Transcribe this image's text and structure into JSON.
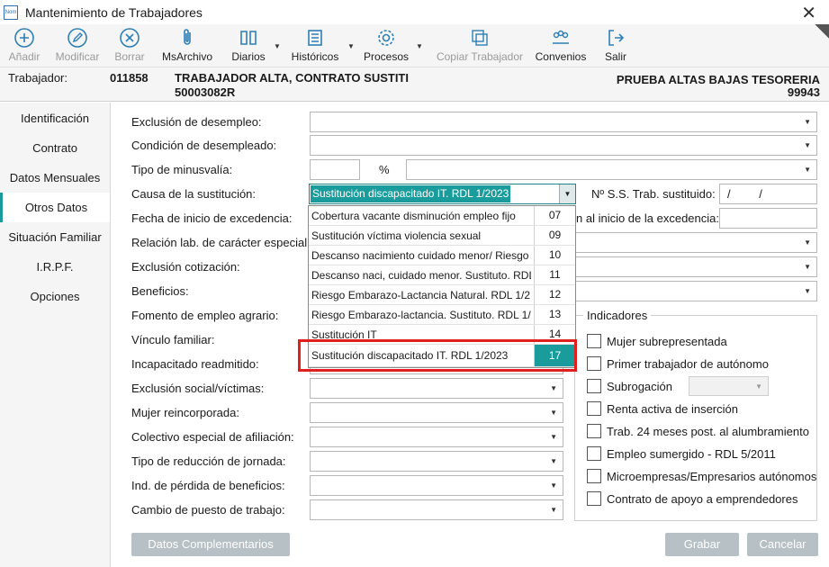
{
  "window": {
    "title": "Mantenimiento de Trabajadores",
    "icon_text": "Nom"
  },
  "toolbar": {
    "anadir": "Añadir",
    "modificar": "Modificar",
    "borrar": "Borrar",
    "msarchivo": "MsArchivo",
    "diarios": "Diarios",
    "historicos": "Históricos",
    "procesos": "Procesos",
    "copiar": "Copiar Trabajador",
    "convenios": "Convenios",
    "salir": "Salir"
  },
  "info": {
    "trabajador_label": "Trabajador:",
    "codigo": "011858",
    "nombre": "TRABAJADOR ALTA, CONTRATO SUSTITI",
    "id": "50003082R",
    "empresa": "PRUEBA ALTAS BAJAS TESORERIA",
    "empresa_code": "99943"
  },
  "nav": [
    "Identificación",
    "Contrato",
    "Datos Mensuales",
    "Otros Datos",
    "Situación Familiar",
    "I.R.P.F.",
    "Opciones"
  ],
  "fields": {
    "exclusion_desempleo": "Exclusión de desempleo:",
    "condicion_desempleado": "Condición de desempleado:",
    "tipo_minusvalia": "Tipo de minusvalía:",
    "percent": "%",
    "causa_sustitucion": "Causa de la sustitución:",
    "causa_value": "Sustitución discapacitado IT. RDL 1/2023",
    "nss_label": "Nº S.S. Trab. sustituido:",
    "nss_value": "/ /",
    "fecha_inicio": "Fecha de inicio de excedencia:",
    "inicio_excedencia_partial": "n al inicio de la excedencia:",
    "relacion_lab": "Relación lab. de carácter especial:",
    "exclusion_cotizacion": "Exclusión cotización:",
    "beneficios": "Beneficios:",
    "fomento_empleo": "Fomento de empleo agrario:",
    "vinculo_familiar": "Vínculo familiar:",
    "incapacitado": "Incapacitado readmitido:",
    "exclusion_social": "Exclusión social/víctimas:",
    "mujer_reincorporada": "Mujer reincorporada:",
    "colectivo_especial": "Colectivo especial de afiliación:",
    "tipo_reduccion": "Tipo de reducción de jornada:",
    "ind_perdida": "Ind. de pérdida de beneficios:",
    "cambio_puesto": "Cambio de puesto de trabajo:"
  },
  "dropdown": [
    {
      "label": "Cobertura vacante disminución empleo fijo",
      "code": "07"
    },
    {
      "label": "Sustitución víctima violencia sexual",
      "code": "09"
    },
    {
      "label": "Descanso nacimiento cuidado menor/ Riesgo",
      "code": "10"
    },
    {
      "label": "Descanso naci, cuidado menor. Sustituto. RDL",
      "code": "11"
    },
    {
      "label": "Riesgo Embarazo-Lactancia Natural. RDL 1/2",
      "code": "12"
    },
    {
      "label": "Riesgo Embarazo-lactancia. Sustituto. RDL 1/",
      "code": "13"
    },
    {
      "label": "Sustitución IT",
      "code": "14"
    },
    {
      "label": "Sustitución discapacitado IT. RDL 1/2023",
      "code": "17"
    }
  ],
  "indicadores": {
    "title": "Indicadores",
    "items": [
      "Mujer subrepresentada",
      "Primer trabajador de autónomo",
      "Subrogación",
      "Renta activa de inserción",
      "Trab. 24 meses post. al alumbramiento",
      "Empleo sumergido - RDL 5/2011",
      "Microempresas/Empresarios autónomos",
      "Contrato de apoyo a emprendedores"
    ]
  },
  "buttons": {
    "datos_complementarios": "Datos Complementarios",
    "grabar": "Grabar",
    "cancelar": "Cancelar"
  }
}
